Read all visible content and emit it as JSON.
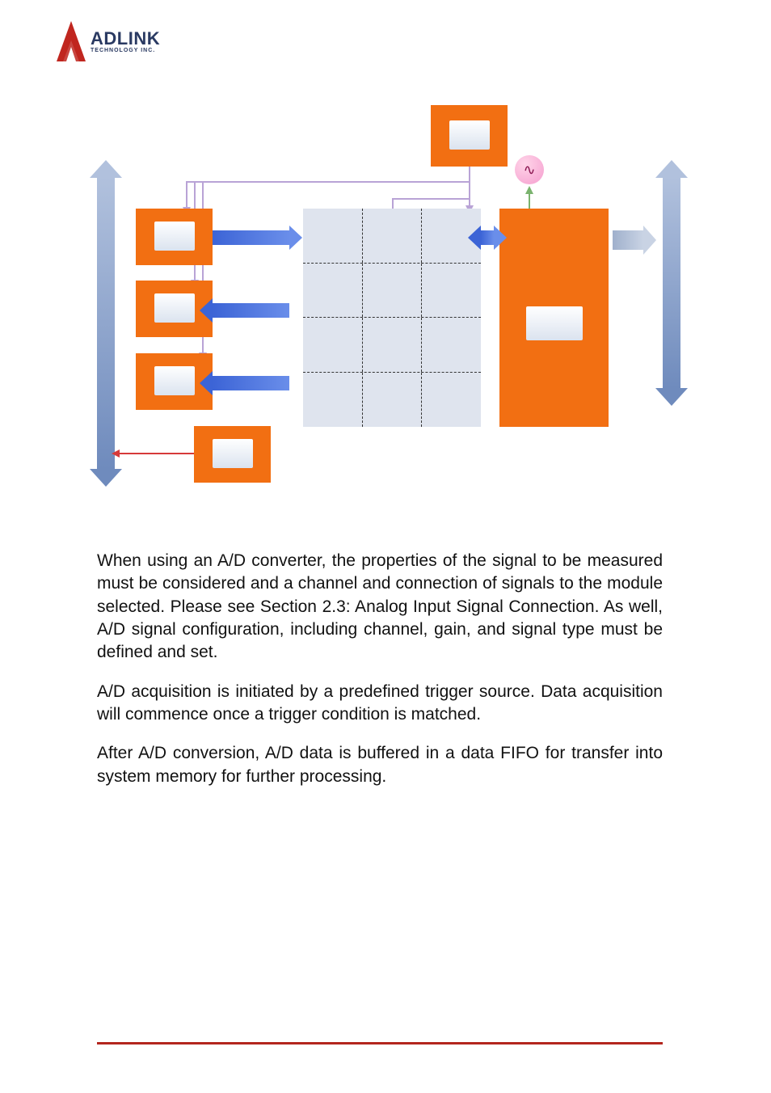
{
  "logo": {
    "name": "ADLINK",
    "sub": "TECHNOLOGY INC."
  },
  "body": {
    "p1": "When using an A/D converter, the properties of the signal to be measured must be considered and a channel and connection of signals to the module selected. Please see Section 2.3: Analog Input Signal Connection. As well, A/D signal configuration, including channel, gain, and signal type must be defined and set.",
    "p2": "A/D acquisition is initiated by a predefined trigger source. Data acquisition will commence once a trigger condition is matched.",
    "p3": "After A/D conversion, A/D data is buffered in a data FIFO for transfer into system memory for further processing."
  }
}
